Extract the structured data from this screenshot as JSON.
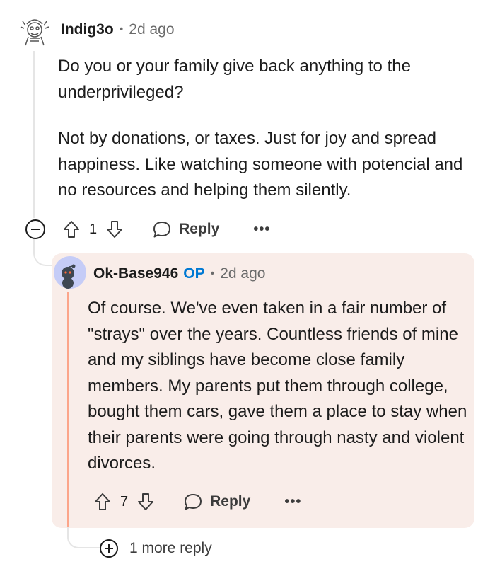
{
  "comment": {
    "author": "Indig3o",
    "separator": "•",
    "time": "2d ago",
    "paragraphs": [
      "Do you or your family give back anything to the underprivileged?",
      "Not by donations, or taxes. Just for joy and spread happiness. Like watching someone with potencial and no resources and helping them silently."
    ],
    "votes": "1",
    "reply_label": "Reply",
    "more_label": "•••"
  },
  "reply": {
    "author": "Ok-Base946",
    "op_badge": "OP",
    "separator": "•",
    "time": "2d ago",
    "body": "Of course. We've even taken in a fair number of \"strays\" over the years. Countless friends of mine and my siblings have become close family members. My parents put them through college, bought them cars, gave them a place to stay when their parents were going through nasty and violent divorces.",
    "votes": "7",
    "reply_label": "Reply",
    "more_label": "•••",
    "highlight_color": "#f9ede9",
    "op_color": "#0079d3"
  },
  "more_replies": {
    "label": "1 more reply"
  }
}
